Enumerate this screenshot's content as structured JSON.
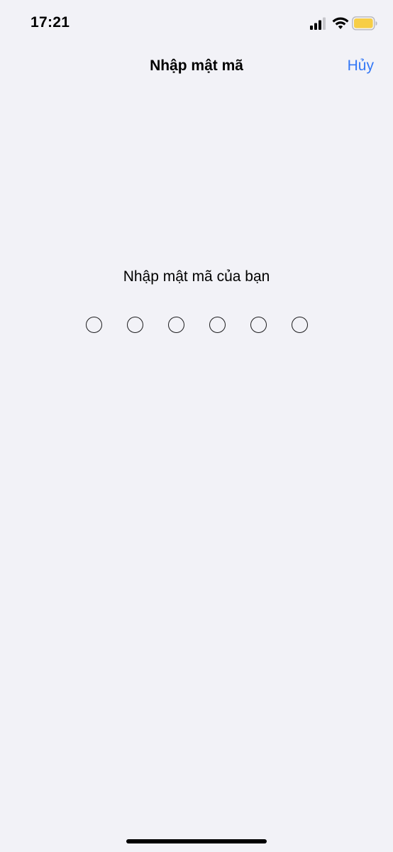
{
  "status_bar": {
    "time": "17:21",
    "signal_icon": "cellular-signal-icon",
    "wifi_icon": "wifi-icon",
    "battery_icon": "battery-icon",
    "battery_color": "#f7ce46"
  },
  "nav": {
    "title": "Nhập mật mã",
    "cancel_label": "Hủy",
    "accent_color": "#3478f6"
  },
  "passcode": {
    "prompt": "Nhập mật mã của bạn",
    "length": 6,
    "entered": 0
  }
}
